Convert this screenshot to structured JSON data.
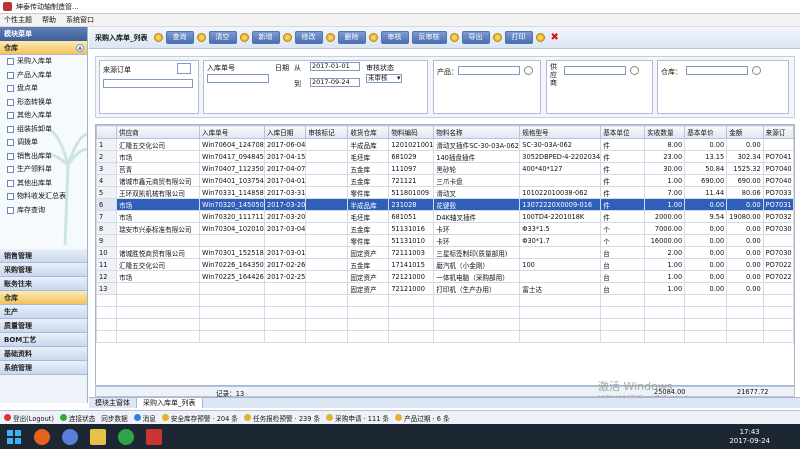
{
  "window": {
    "title": "坤泰传动轴制造管..."
  },
  "menu": [
    "个性主题",
    "帮助",
    "系统窗口"
  ],
  "sidebar": {
    "header": "模块菜单",
    "top_category": "仓库",
    "items": [
      "采购入库单",
      "产品入库单",
      "盘点单",
      "形态转换单",
      "其他入库单",
      "组装拆卸单",
      "调拨单",
      "销售出库单",
      "生产领料单",
      "其他出库单",
      "物料收发汇总表",
      "库存查询"
    ],
    "categories": [
      "销售管理",
      "采购管理",
      "账务往来",
      "仓库",
      "生产",
      "质量管理",
      "BOM工艺",
      "基础资料",
      "系统管理"
    ]
  },
  "toolbar": {
    "title": "采购入库单_列表",
    "buttons": [
      "查询",
      "清空",
      "新增",
      "修改",
      "删除",
      "审核",
      "反审核",
      "导出",
      "打印"
    ]
  },
  "filter": {
    "order_label": "来源订单",
    "inbound_label": "入库单号",
    "date_label": "日期",
    "from_label": "从",
    "to_label": "到",
    "date_from": "2017-01-01",
    "date_to": "2017-09-24",
    "audit_label": "审核状态",
    "audit_value": "未审核",
    "product_label": "产品：",
    "supplier_label": "供应商",
    "warehouse_label": "仓库："
  },
  "grid": {
    "columns": [
      "",
      "供应商",
      "入库单号",
      "入库日期",
      "审核标记",
      "收货仓库",
      "物料编码",
      "物料名称",
      "规格型号",
      "基本单位",
      "实收数量",
      "基本单价",
      "金额",
      "来源订"
    ],
    "rows": [
      [
        "1",
        "汇隆五交化公司",
        "Win70604_124708",
        "2017-06-04",
        "",
        "半成品库",
        "1201021001",
        "滑动叉插件SC-30-03A-062",
        "SC-30-03A-062",
        "件",
        "8.00",
        "0.00",
        "0.00",
        ""
      ],
      [
        "2",
        "市场",
        "Win70417_094845",
        "2017-04-15",
        "",
        "毛坯库",
        "681029",
        "140插盘插件",
        "3052DBPED-4-2202034",
        "件",
        "23.00",
        "13.15",
        "302.34",
        "PO7041"
      ],
      [
        "3",
        "莒青",
        "Win70407_112350",
        "2017-04-07",
        "",
        "五金库",
        "111097",
        "黑砂轮",
        "400*40*127",
        "件",
        "30.00",
        "50.84",
        "1525.32",
        "PO7040"
      ],
      [
        "4",
        "诸城市鑫元商贸有限公司",
        "Win70401_103754",
        "2017-04-01",
        "",
        "五金库",
        "721121",
        "三爪卡盘",
        "",
        "件",
        "1.00",
        "690.00",
        "690.00",
        "PO7040"
      ],
      [
        "5",
        "王环双凯机械有限公司",
        "Win70331_114858",
        "2017-03-31",
        "",
        "零件库",
        "511801009",
        "滑动叉",
        "101022010038-062",
        "件",
        "7.00",
        "11.44",
        "80.06",
        "PO7033"
      ],
      [
        "6",
        "市场",
        "Win70320_145050",
        "2017-03-20",
        "",
        "半成品库",
        "231028",
        "花键毂",
        "13072220X0009-016",
        "件",
        "1.00",
        "0.00",
        "0.00",
        "PO7031"
      ],
      [
        "7",
        "市场",
        "Win70320_111711",
        "2017-03-20",
        "",
        "毛坯库",
        "681051",
        "D4K轴叉插件",
        "100TD4-2201018K",
        "件",
        "2000.00",
        "9.54",
        "19080.00",
        "PO7032"
      ],
      [
        "8",
        "瑞安市兴泰标准有限公司",
        "Win70304_102010",
        "2017-03-04",
        "",
        "五金库",
        "51131016",
        "卡环",
        "Φ33*1.5",
        "个",
        "7000.00",
        "0.00",
        "0.00",
        "PO7030"
      ],
      [
        "9",
        "",
        "",
        "",
        "",
        "零件库",
        "51131010",
        "卡环",
        "Φ30*1.7",
        "个",
        "16000.00",
        "0.00",
        "0.00",
        ""
      ],
      [
        "10",
        "诸城胜悦商贸有限公司",
        "Win70301_152518",
        "2017-03-01",
        "",
        "固定资产",
        "72111003",
        "三星标签制印(质量部用)",
        "",
        "台",
        "2.00",
        "0.00",
        "0.00",
        "PO7030"
      ],
      [
        "11",
        "汇隆五交化公司",
        "Win70226_164350",
        "2017-02-26",
        "",
        "五金库",
        "17141015",
        "磨汽机（小金刚）",
        "100",
        "台",
        "1.00",
        "0.00",
        "0.00",
        "PO7022"
      ],
      [
        "12",
        "市场",
        "Win70225_164426",
        "2017-02-25",
        "",
        "固定资产",
        "72121000",
        "一体机电脑（采购部用）",
        "",
        "台",
        "1.00",
        "0.00",
        "0.00",
        "PO7022"
      ],
      [
        "13",
        "",
        "",
        "",
        "",
        "固定资产",
        "72121000",
        "打印机（生产办用）",
        "富士达",
        "台",
        "1.00",
        "0.00",
        "0.00",
        ""
      ]
    ],
    "footer": {
      "record_label": "记录：13",
      "qty_total": "25084.00",
      "amount_total": "21677.72"
    }
  },
  "tabs": [
    "模块主窗体",
    "采购入库单_列表"
  ],
  "status": [
    "登出(Logout)",
    "连接状态",
    "同步数据",
    "消息",
    "安全库存预警 · 204 条",
    "任务报检预警 · 239 条",
    "采购申请 · 111 条",
    "产品过期 · 6 条"
  ],
  "watermark": {
    "line1": "激活 Windows",
    "line2": "转到\"控制面板\"以激活 Windows。"
  },
  "clock": {
    "time": "17:43",
    "date": "2017-09-24"
  }
}
